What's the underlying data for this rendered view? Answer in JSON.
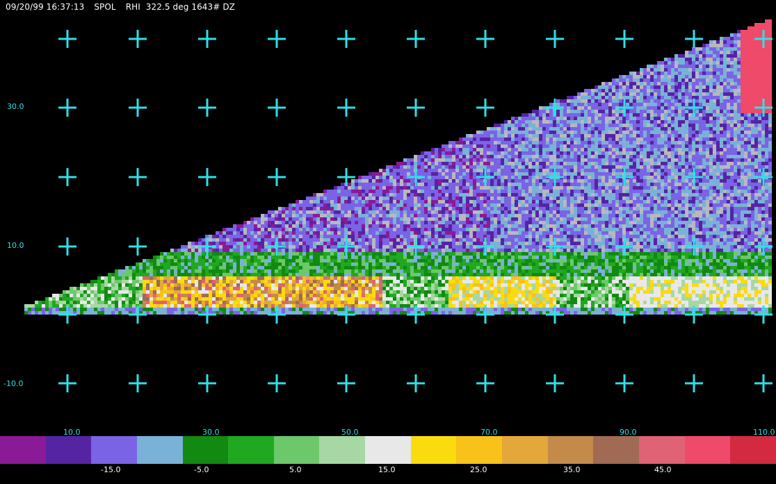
{
  "header": {
    "datetime": "09/20/99 16:37:13",
    "radar": "SPOL",
    "scan": "RHI  322.5 deg 1643# DZ"
  },
  "y_axis_labels": [
    "30.0",
    "10.0",
    "-10.0"
  ],
  "x_axis_labels": [
    "10.0",
    "30.0",
    "50.0",
    "70.0",
    "90.0",
    "110.0"
  ],
  "colorbar": {
    "colors": [
      "#8b1a96",
      "#5524a3",
      "#7b63e6",
      "#79b2d6",
      "#128a12",
      "#21a821",
      "#6cc86a",
      "#a7d8a4",
      "#e8e8e8",
      "#fadc0e",
      "#f8c21a",
      "#e4a73a",
      "#c48a4a",
      "#a06a55",
      "#e06275",
      "#f04a6a",
      "#d42a40"
    ],
    "labels": [
      "-15.0",
      "-5.0",
      "5.0",
      "15.0",
      "25.0",
      "35.0",
      "45.0"
    ]
  },
  "grid_color": "#2fe0e8"
}
